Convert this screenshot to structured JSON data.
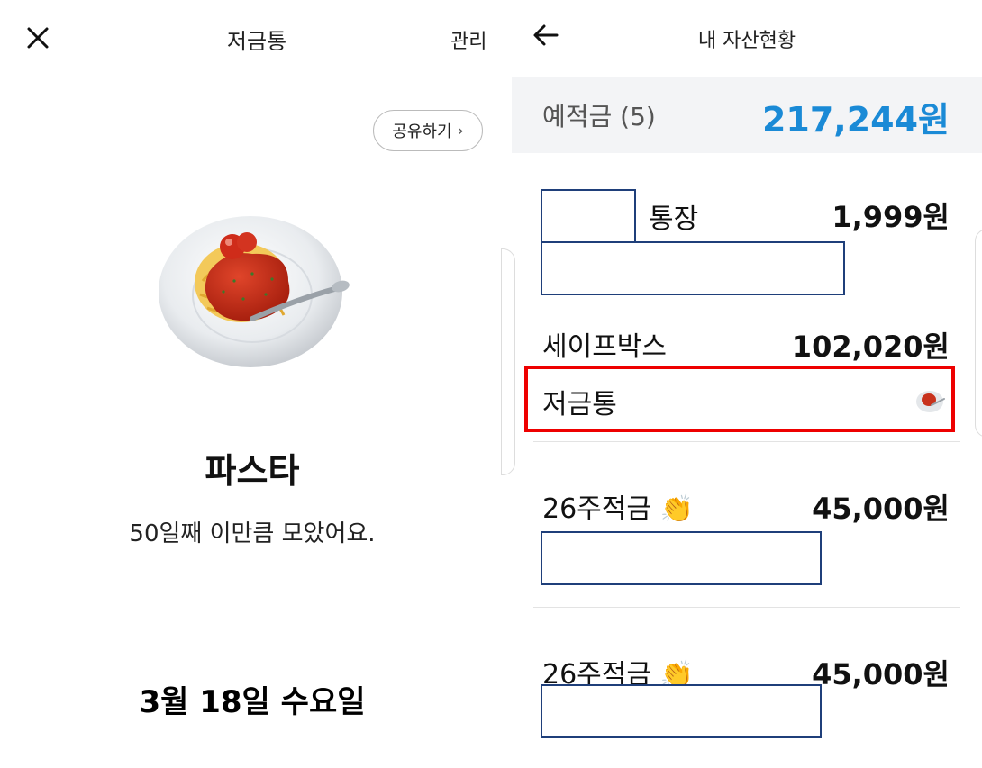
{
  "left": {
    "title": "저금통",
    "manage_label": "관리",
    "share_label": "공유하기",
    "item_name": "파스타",
    "subtitle": "50일째 이만큼 모았어요.",
    "date": "3월 18일 수요일"
  },
  "right": {
    "title": "내 자산현황",
    "summary": {
      "label": "예적금 (5)",
      "value": "217,244원",
      "value_color": "#1a8ad6"
    },
    "accounts": [
      {
        "label": "통장",
        "value": "1,999원"
      },
      {
        "label": "세이프박스",
        "value": "102,020원"
      },
      {
        "label": "저금통"
      },
      {
        "label": "26주적금",
        "value": "45,000원"
      },
      {
        "label": "26주적금",
        "value": "45,000원"
      }
    ],
    "highlight_color": "#ee0000"
  }
}
